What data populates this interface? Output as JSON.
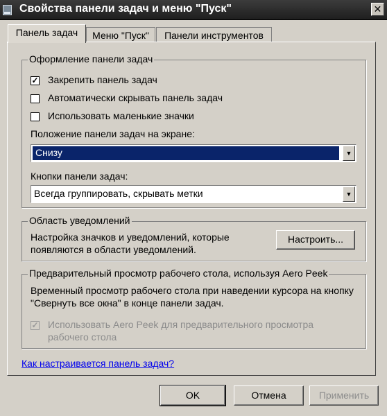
{
  "window": {
    "title": "Свойства панели задач и меню \"Пуск\""
  },
  "tabs": [
    {
      "label": "Панель задач"
    },
    {
      "label": "Меню \"Пуск\""
    },
    {
      "label": "Панели инструментов"
    }
  ],
  "appearance": {
    "legend": "Оформление панели задач",
    "lock_taskbar": {
      "label": "Закрепить панель задач",
      "checked": true
    },
    "auto_hide": {
      "label": "Автоматически скрывать панель задач",
      "checked": false
    },
    "small_icons": {
      "label": "Использовать маленькие значки",
      "checked": false
    },
    "location_label": "Положение панели задач на экране:",
    "location_value": "Снизу",
    "buttons_label": "Кнопки панели задач:",
    "buttons_value": "Всегда группировать, скрывать метки"
  },
  "notifications": {
    "legend": "Область уведомлений",
    "description": "Настройка значков и уведомлений, которые появляются в области уведомлений.",
    "customize_button": "Настроить..."
  },
  "aero_peek": {
    "legend": "Предварительный просмотр рабочего стола, используя Aero Peek",
    "description": "Временный просмотр рабочего стола при наведении курсора на кнопку \"Свернуть все окна\" в конце панели задач.",
    "checkbox_label": "Использовать Aero Peek для предварительного просмотра рабочего стола",
    "checked": true
  },
  "help_link": "Как настраивается панель задач?",
  "buttons": {
    "ok": "OK",
    "cancel": "Отмена",
    "apply": "Применить"
  }
}
